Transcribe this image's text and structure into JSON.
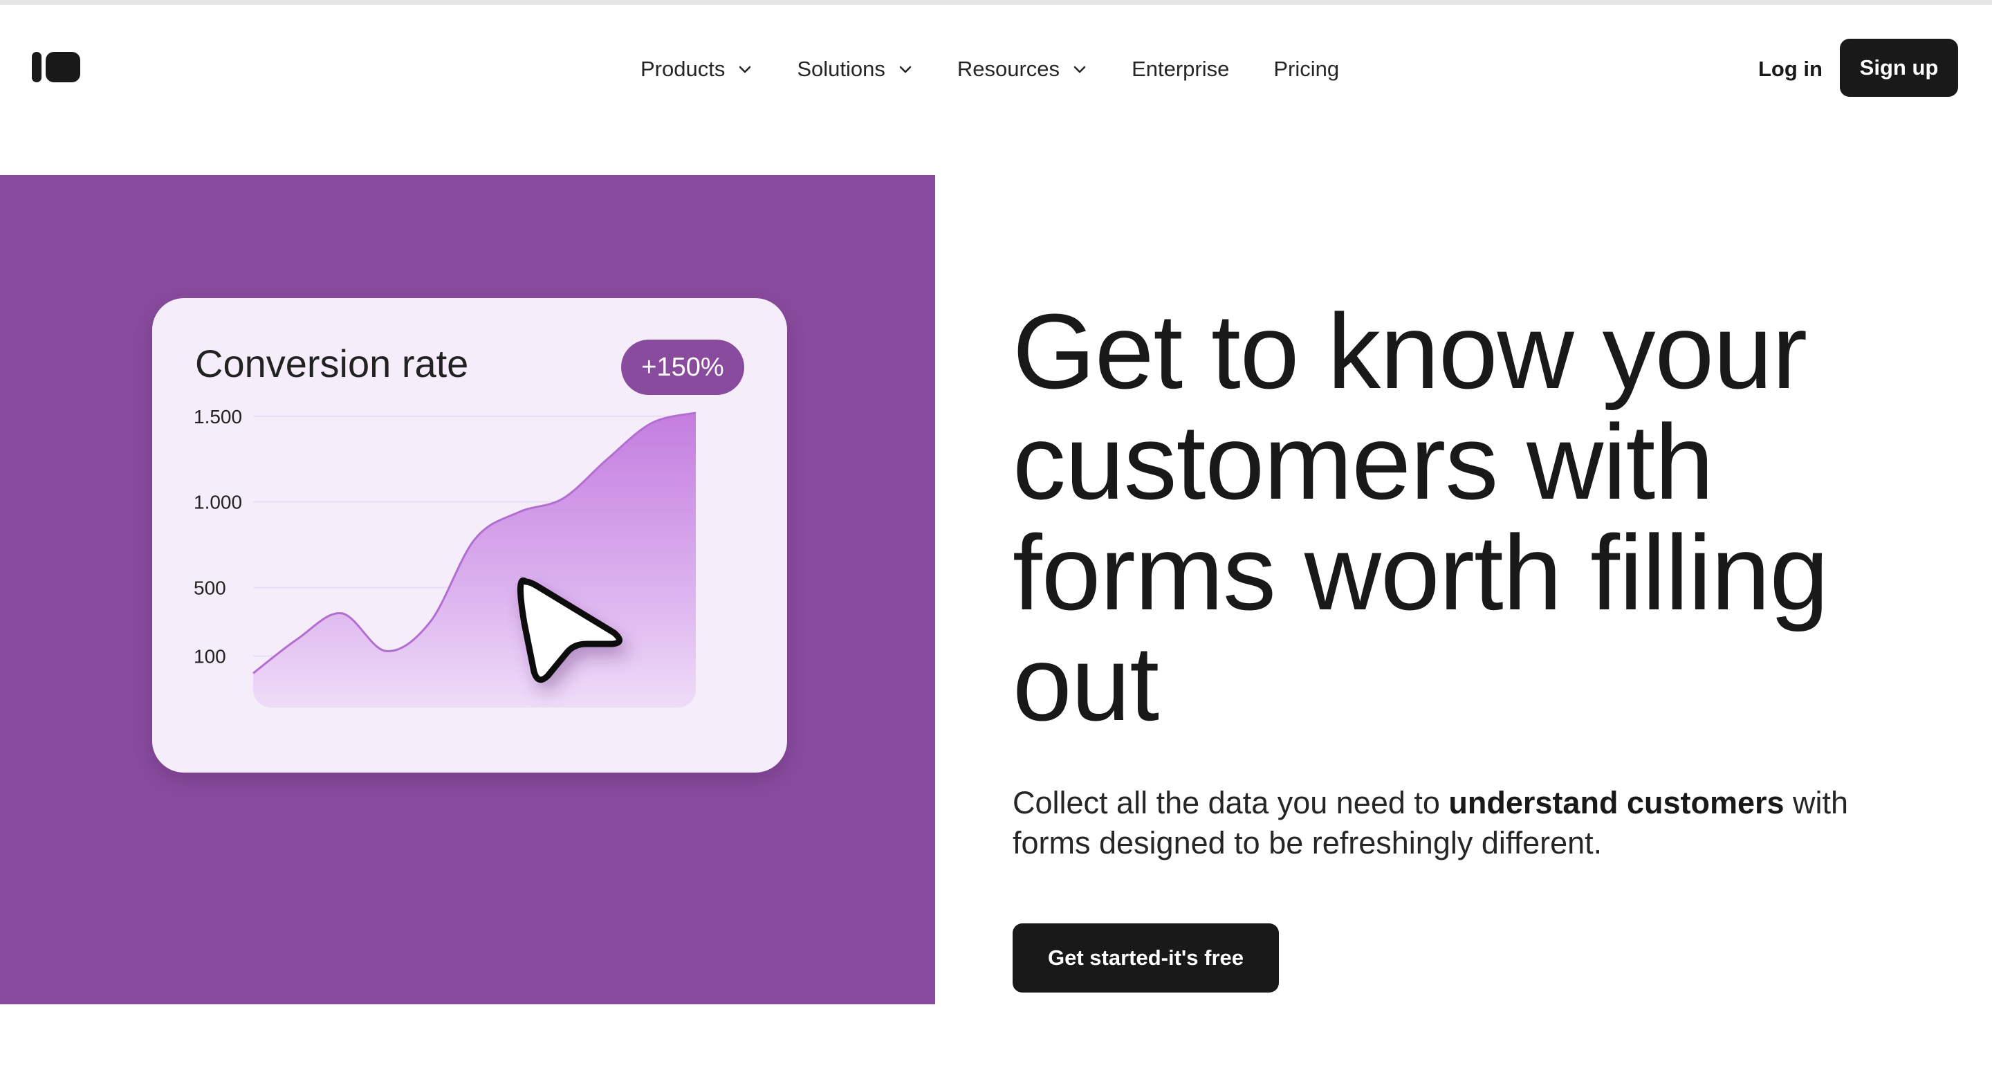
{
  "header": {
    "logo_icon": "brand-logo-icon",
    "nav": [
      {
        "label": "Products",
        "dropdown": true
      },
      {
        "label": "Solutions",
        "dropdown": true
      },
      {
        "label": "Resources",
        "dropdown": true
      },
      {
        "label": "Enterprise",
        "dropdown": false
      },
      {
        "label": "Pricing",
        "dropdown": false
      }
    ],
    "login_label": "Log in",
    "signup_label": "Sign up"
  },
  "hero": {
    "panel_color": "#894b9d",
    "card": {
      "title": "Conversion rate",
      "badge": "+150%"
    },
    "headline": "Get to know your customers with forms worth filling out",
    "subtext_before": "Collect all the data you need to ",
    "subtext_bold": "understand customers",
    "subtext_after": " with forms designed to be refreshingly different.",
    "cta_label": "Get started-it's free",
    "cursor_icon": "cursor-arrow-icon"
  },
  "colors": {
    "accent": "#894b9d",
    "dark": "#191919",
    "chart_fill": "#c98ae0"
  },
  "chart_data": {
    "type": "area",
    "title": "Conversion rate",
    "badge": "+150%",
    "y_ticks": [
      "1.500",
      "1.000",
      "500",
      "100"
    ],
    "y_tick_values": [
      1500,
      1000,
      500,
      100
    ],
    "x": [
      0,
      1,
      2,
      3,
      4,
      5,
      6,
      7,
      8,
      9,
      10
    ],
    "values": [
      0,
      200,
      350,
      130,
      300,
      780,
      940,
      1020,
      1250,
      1460,
      1520
    ],
    "ylim": [
      -200,
      1600
    ],
    "grid": true
  }
}
